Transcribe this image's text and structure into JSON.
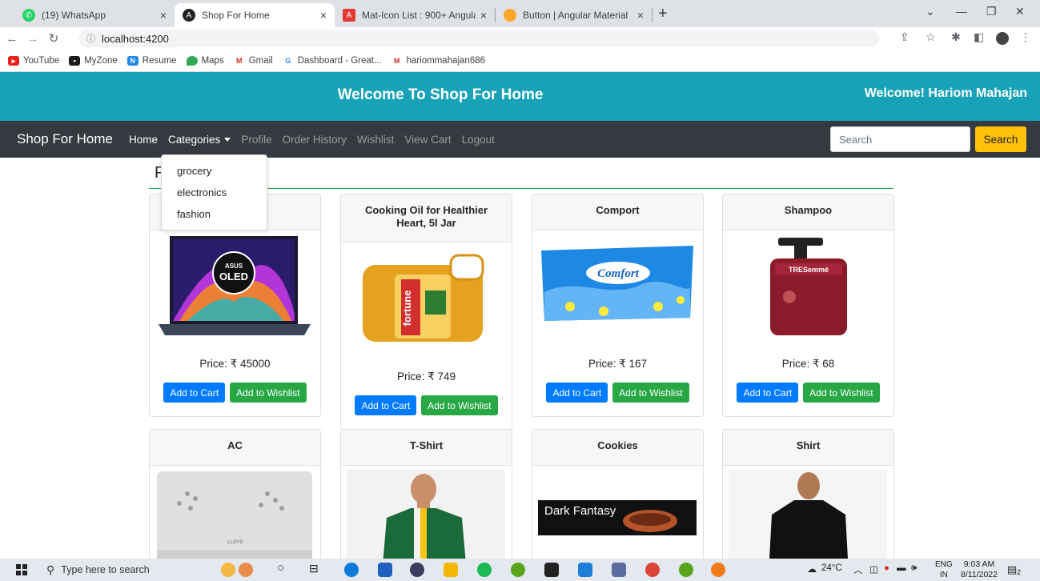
{
  "browser": {
    "tabs": [
      {
        "title": "(19) WhatsApp",
        "active": false
      },
      {
        "title": "Shop For Home",
        "active": true
      },
      {
        "title": "Mat-Icon List : 900+ Angular Ma",
        "active": false
      },
      {
        "title": "Button | Angular Material",
        "active": false
      }
    ],
    "url": "localhost:4200",
    "bookmarks": [
      "YouTube",
      "MyZone",
      "Resume",
      "Maps",
      "Gmail",
      "Dashboard - Great...",
      "hariommahajan686"
    ]
  },
  "header": {
    "title": "Welcome To Shop For Home",
    "welcome": "Welcome! Hariom Mahajan"
  },
  "navbar": {
    "brand": "Shop For Home",
    "home": "Home",
    "categories": "Categories",
    "profile": "Profile",
    "order_history": "Order History",
    "wishlist": "Wishlist",
    "view_cart": "View Cart",
    "logout": "Logout",
    "search_placeholder": "Search",
    "search_button": "Search"
  },
  "dropdown": [
    "grocery",
    "electronics",
    "fashion"
  ],
  "section_title": "P",
  "products": [
    {
      "name": "",
      "price": "Price: ₹ 45000",
      "add_to_cart": "Add to Cart",
      "add_to_wishlist": "Add to Wishlist"
    },
    {
      "name": "Cooking Oil for Healthier Heart, 5l Jar",
      "price": "Price: ₹ 749",
      "add_to_cart": "Add to Cart",
      "add_to_wishlist": "Add to Wishlist"
    },
    {
      "name": "Comport",
      "price": "Price: ₹ 167",
      "add_to_cart": "Add to Cart",
      "add_to_wishlist": "Add to Wishlist"
    },
    {
      "name": "Shampoo",
      "price": "Price: ₹ 68",
      "add_to_cart": "Add to Cart",
      "add_to_wishlist": "Add to Wishlist"
    },
    {
      "name": "AC"
    },
    {
      "name": "T-Shirt"
    },
    {
      "name": "Cookies"
    },
    {
      "name": "Shirt"
    }
  ],
  "image_text": {
    "laptop_brand": "ASUS",
    "laptop_oled": "OLED",
    "oil_brand": "fortune",
    "comfort_brand": "Comfort",
    "shampoo_brand": "TRESemmé",
    "ac_brand": "LLOYD",
    "cookies_brand": "Dark Fantasy"
  },
  "taskbar": {
    "search_placeholder": "Type here to search",
    "temperature": "24°C",
    "language": "ENG",
    "region": "IN",
    "time": "9:03 AM",
    "date": "8/11/2022",
    "notifications": "2"
  },
  "colors": {
    "hero": "#17a2b8",
    "navbar": "#343a40",
    "search_button": "#ffc107",
    "cart_button": "#007bff",
    "wishlist_button": "#28a745"
  }
}
